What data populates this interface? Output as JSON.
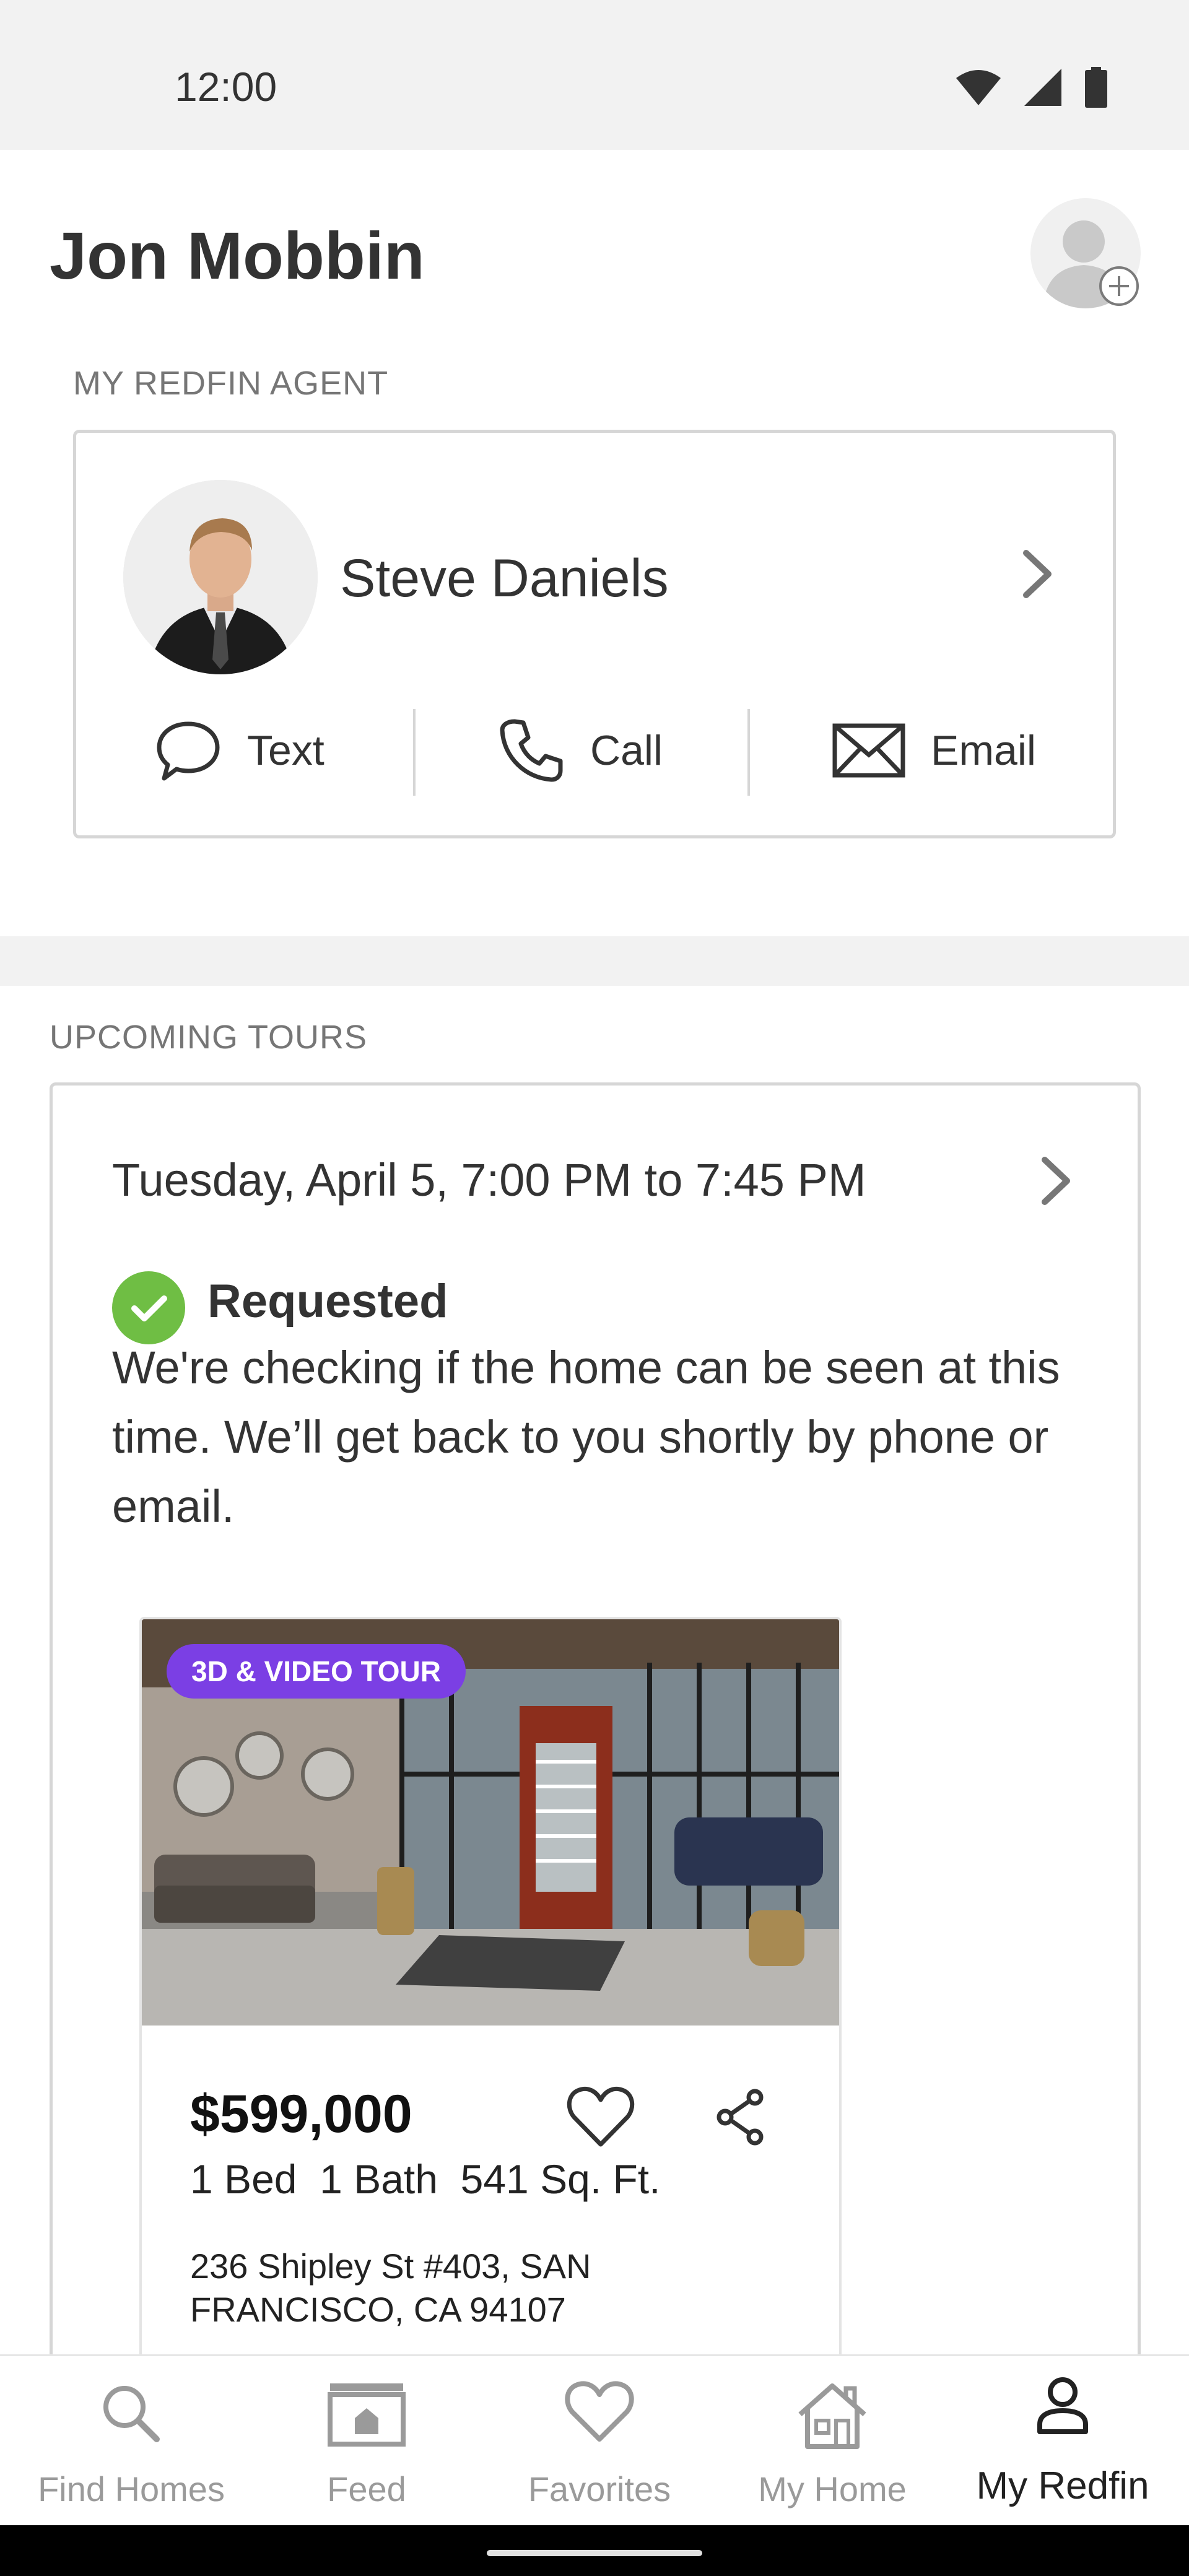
{
  "status_bar": {
    "time": "12:00"
  },
  "header": {
    "user_name": "Jon Mobbin"
  },
  "agent_section": {
    "label": "MY REDFIN AGENT",
    "agent_name": "Steve Daniels",
    "actions": {
      "text": "Text",
      "call": "Call",
      "email": "Email"
    }
  },
  "tours_section": {
    "label": "UPCOMING TOURS",
    "tour": {
      "date_time": "Tuesday, April 5, 7:00 PM to 7:45 PM",
      "status": "Requested",
      "status_message": "We're checking if the home can be seen at this time. We’ll get back to you shortly by phone or email.",
      "listing": {
        "badge": "3D & VIDEO TOUR",
        "price": "$599,000",
        "facts": "1 Bed  1 Bath  541 Sq. Ft.",
        "address": "236 Shipley St #403, SAN FRANCISCO, CA 94107"
      }
    }
  },
  "bottom_nav": {
    "items": [
      {
        "label": "Find Homes",
        "icon": "search-icon"
      },
      {
        "label": "Feed",
        "icon": "feed-icon"
      },
      {
        "label": "Favorites",
        "icon": "heart-icon"
      },
      {
        "label": "My Home",
        "icon": "house-icon"
      },
      {
        "label": "My Redfin",
        "icon": "user-icon"
      }
    ],
    "active": "My Redfin"
  },
  "colors": {
    "requested_green": "#6fbe44",
    "badge_purple": "#7b3fe4",
    "section_label_gray": "#767676",
    "border_gray": "#d6d6d6"
  }
}
